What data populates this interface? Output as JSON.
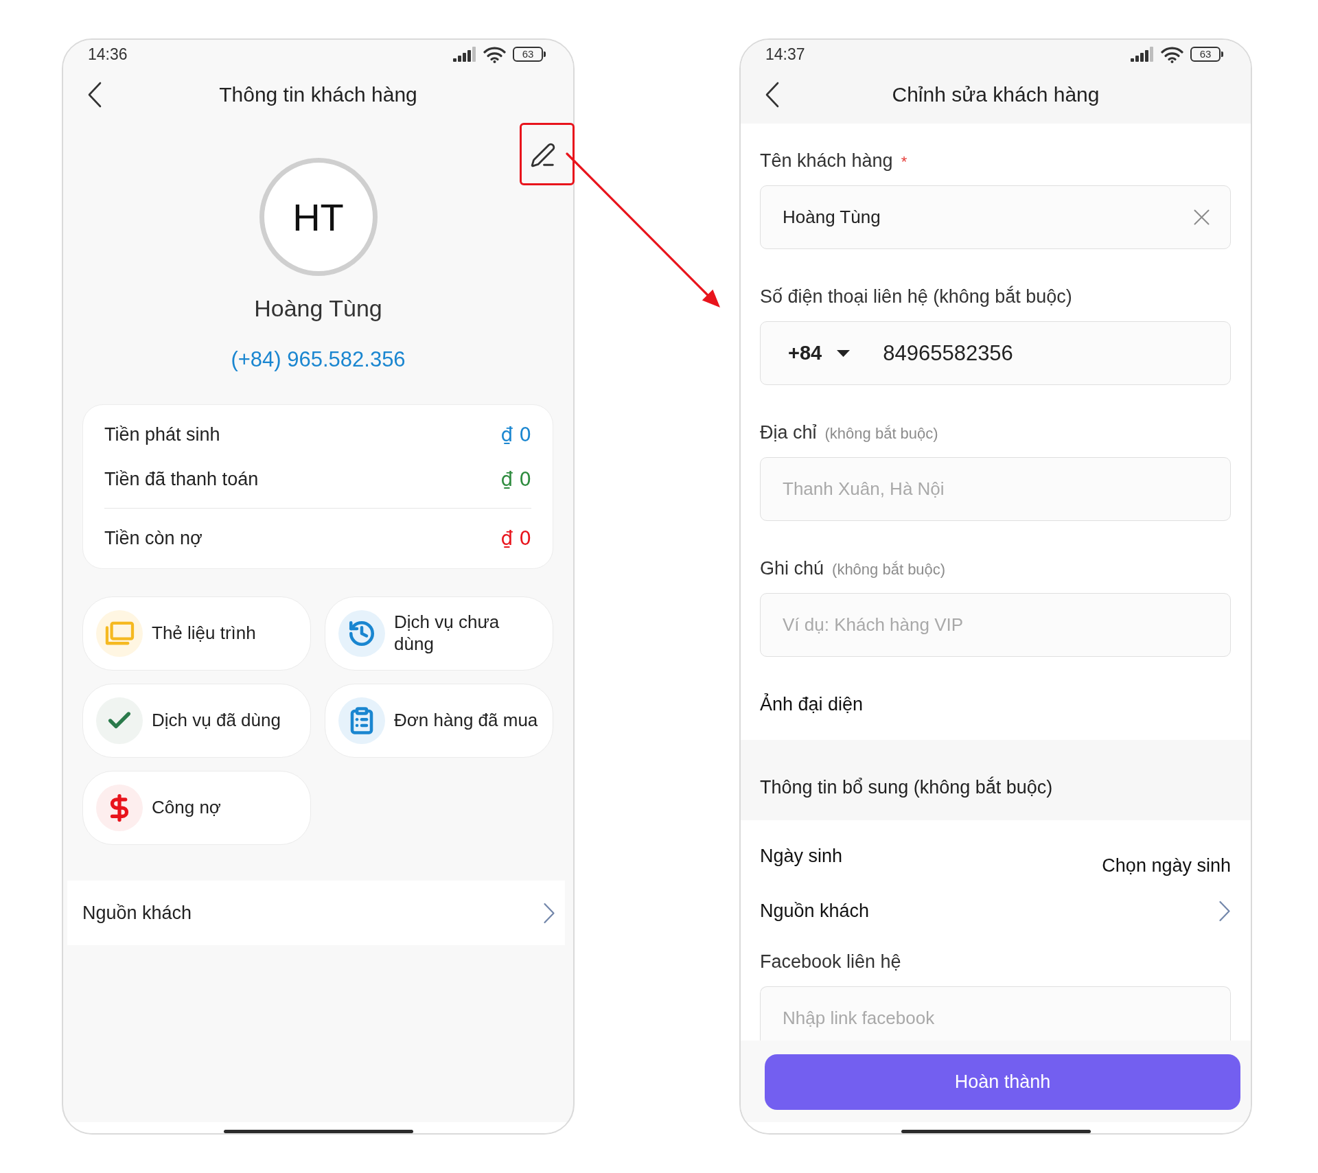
{
  "profile_screen": {
    "status_bar": {
      "time": "14:36",
      "battery": "63"
    },
    "header": {
      "title": "Thông tin khách hàng"
    },
    "avatar": {
      "initials": "HT"
    },
    "customer_name": "Hoàng Tùng",
    "phone": "(+84) 965.582.356",
    "summary": {
      "rows": [
        {
          "kind": "amount",
          "label": "Tiền phát sinh",
          "value": "₫ 0",
          "color": "#1a86d0"
        },
        {
          "kind": "amount",
          "label": "Tiền đã thanh toán",
          "value": "₫ 0",
          "color": "#2e8b3e"
        },
        {
          "kind": "balance",
          "label": "Tiền còn nợ",
          "value": "₫ 0",
          "color": "#e8141c"
        }
      ]
    },
    "shortcuts": [
      {
        "kind": "cards",
        "label": "Thẻ liệu trình"
      },
      {
        "kind": "history",
        "label": "Dịch vụ chưa dùng"
      },
      {
        "kind": "check",
        "label": "Dịch vụ đã dùng"
      },
      {
        "kind": "orders",
        "label": "Đơn hàng đã mua"
      },
      {
        "kind": "debt",
        "label": "Công nợ"
      }
    ],
    "source_row": {
      "label": "Nguồn khách"
    }
  },
  "edit_screen": {
    "status_bar": {
      "time": "14:37",
      "battery": "63"
    },
    "header": {
      "title": "Chỉnh sửa khách hàng"
    },
    "fields": [
      {
        "kind": "text",
        "label": "Tên khách hàng",
        "required_mark": "*",
        "value": "Hoàng Tùng"
      },
      {
        "kind": "phone",
        "label": "Số điện thoại liên hệ (không bắt buộc)",
        "country_code": "+84",
        "value": "84965582356"
      },
      {
        "kind": "text",
        "label": "Địa chỉ",
        "hint": "(không bắt buộc)",
        "placeholder": "Thanh Xuân, Hà Nội"
      },
      {
        "kind": "text",
        "label": "Ghi chú",
        "hint": "(không bắt buộc)",
        "placeholder": "Ví dụ: Khách hàng VIP"
      },
      {
        "kind": "photo",
        "label": "Ảnh đại diện"
      }
    ],
    "section": {
      "title": "Thông tin bổ sung (không bắt buộc)"
    },
    "extra_fields": [
      {
        "kind": "picker",
        "label": "Ngày sinh",
        "value": "Chọn ngày sinh"
      },
      {
        "kind": "link",
        "label": "Nguồn khách"
      },
      {
        "kind": "text",
        "label": "Facebook liên hệ",
        "placeholder": "Nhập link facebook"
      }
    ],
    "submit": {
      "label": "Hoàn thành"
    }
  }
}
